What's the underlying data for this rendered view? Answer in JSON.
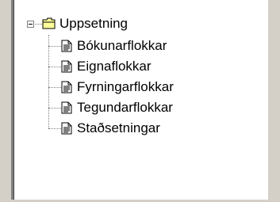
{
  "tree": {
    "root": {
      "label": "Uppsetning",
      "icon": "folder-open-icon",
      "expanded": true
    },
    "children": [
      {
        "label": "Bókunarflokkar",
        "icon": "document-icon"
      },
      {
        "label": "Eignaflokkar",
        "icon": "document-icon"
      },
      {
        "label": "Fyrningarflokkar",
        "icon": "document-icon"
      },
      {
        "label": "Tegundarflokkar",
        "icon": "document-icon"
      },
      {
        "label": "Staðsetningar",
        "icon": "document-icon"
      }
    ]
  },
  "colors": {
    "panel_background": "#ffffff",
    "window_background": "#d4d0c8",
    "folder_fill": "#ffff99",
    "folder_outline": "#000000",
    "tree_lines": "#808080"
  }
}
